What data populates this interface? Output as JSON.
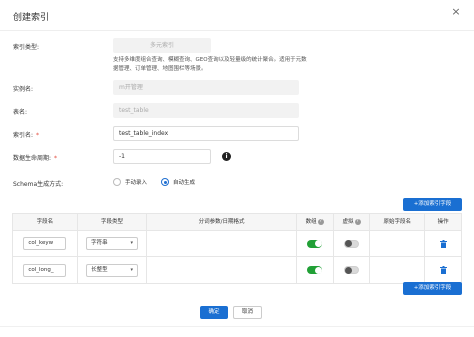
{
  "dialog": {
    "title": "创建索引",
    "close": "×"
  },
  "form": {
    "index_type": {
      "label": "索引类型:",
      "value": "多元索引",
      "help": "支持多维度组合查询、模糊查询、GEO查询以及轻量级的统计聚合。适用于元数据管理、订单管理、地图围栏等场景。"
    },
    "instance": {
      "label": "实例名:",
      "value": "m开管理"
    },
    "table": {
      "label": "表名:",
      "value": "test_table"
    },
    "index_name": {
      "label": "索引名:",
      "required": "*",
      "value": "test_table_index"
    },
    "ttl": {
      "label": "数据生命周期:",
      "required": "*",
      "value": "-1",
      "info_icon": "i"
    },
    "schema_mode": {
      "label": "Schema生成方式:",
      "options": [
        "手动录入",
        "自动生成"
      ],
      "selected": "自动生成"
    }
  },
  "buttons": {
    "add_field_top": "+添加索引字段",
    "add_field_bottom": "+添加索引字段",
    "confirm": "确定",
    "cancel": "取消"
  },
  "table": {
    "headers": {
      "field_name": "字段名",
      "field_type": "字段类型",
      "analyzer": "分词参数/日期格式",
      "array": "数组",
      "virtual": "虚拟",
      "source_field": "原始字段名",
      "action": "操作"
    },
    "header_help": "?",
    "rows": [
      {
        "field_name": "col_keyw",
        "field_type": "字符串",
        "array": true,
        "virtual": false
      },
      {
        "field_name": "col_long_",
        "field_type": "长整型",
        "array": true,
        "virtual": false
      }
    ]
  },
  "colors": {
    "primary": "#1a6fd2",
    "toggle_on": "#21a036",
    "required": "#e34a3c"
  }
}
